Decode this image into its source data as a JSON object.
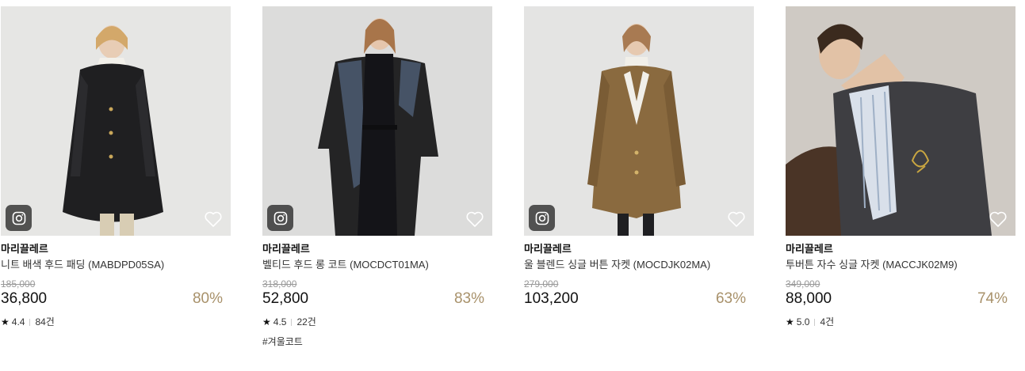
{
  "products": [
    {
      "brand": "마리끌레르",
      "name": "니트 배색 후드 패딩 (MABDPD05SA)",
      "original_price": "185,000",
      "price": "36,800",
      "discount": "80%",
      "rating": "4.4",
      "reviews": "84건",
      "icon": "instagram-icon",
      "photo_bg": "#e6e6e4"
    },
    {
      "brand": "마리끌레르",
      "name": "벨티드 후드 롱 코트 (MOCDCT01MA)",
      "original_price": "318,000",
      "price": "52,800",
      "discount": "83%",
      "rating": "4.5",
      "reviews": "22건",
      "tag": "#겨울코트",
      "icon": "instagram-icon",
      "photo_bg": "#dcdcdb"
    },
    {
      "brand": "마리끌레르",
      "name": "울 블렌드 싱글 버튼 자켓 (MOCDJK02MA)",
      "original_price": "279,000",
      "price": "103,200",
      "discount": "63%",
      "icon": "instagram-icon",
      "photo_bg": "#e4e4e3"
    },
    {
      "brand": "마리끌레르",
      "name": "투버튼 자수 싱글 자켓 (MACCJK02M9)",
      "original_price": "349,000",
      "price": "88,000",
      "discount": "74%",
      "rating": "5.0",
      "reviews": "4건",
      "photo_bg": "#d8d4cf"
    }
  ],
  "colors": {
    "discount": "#a8916a",
    "strike": "#999999"
  }
}
